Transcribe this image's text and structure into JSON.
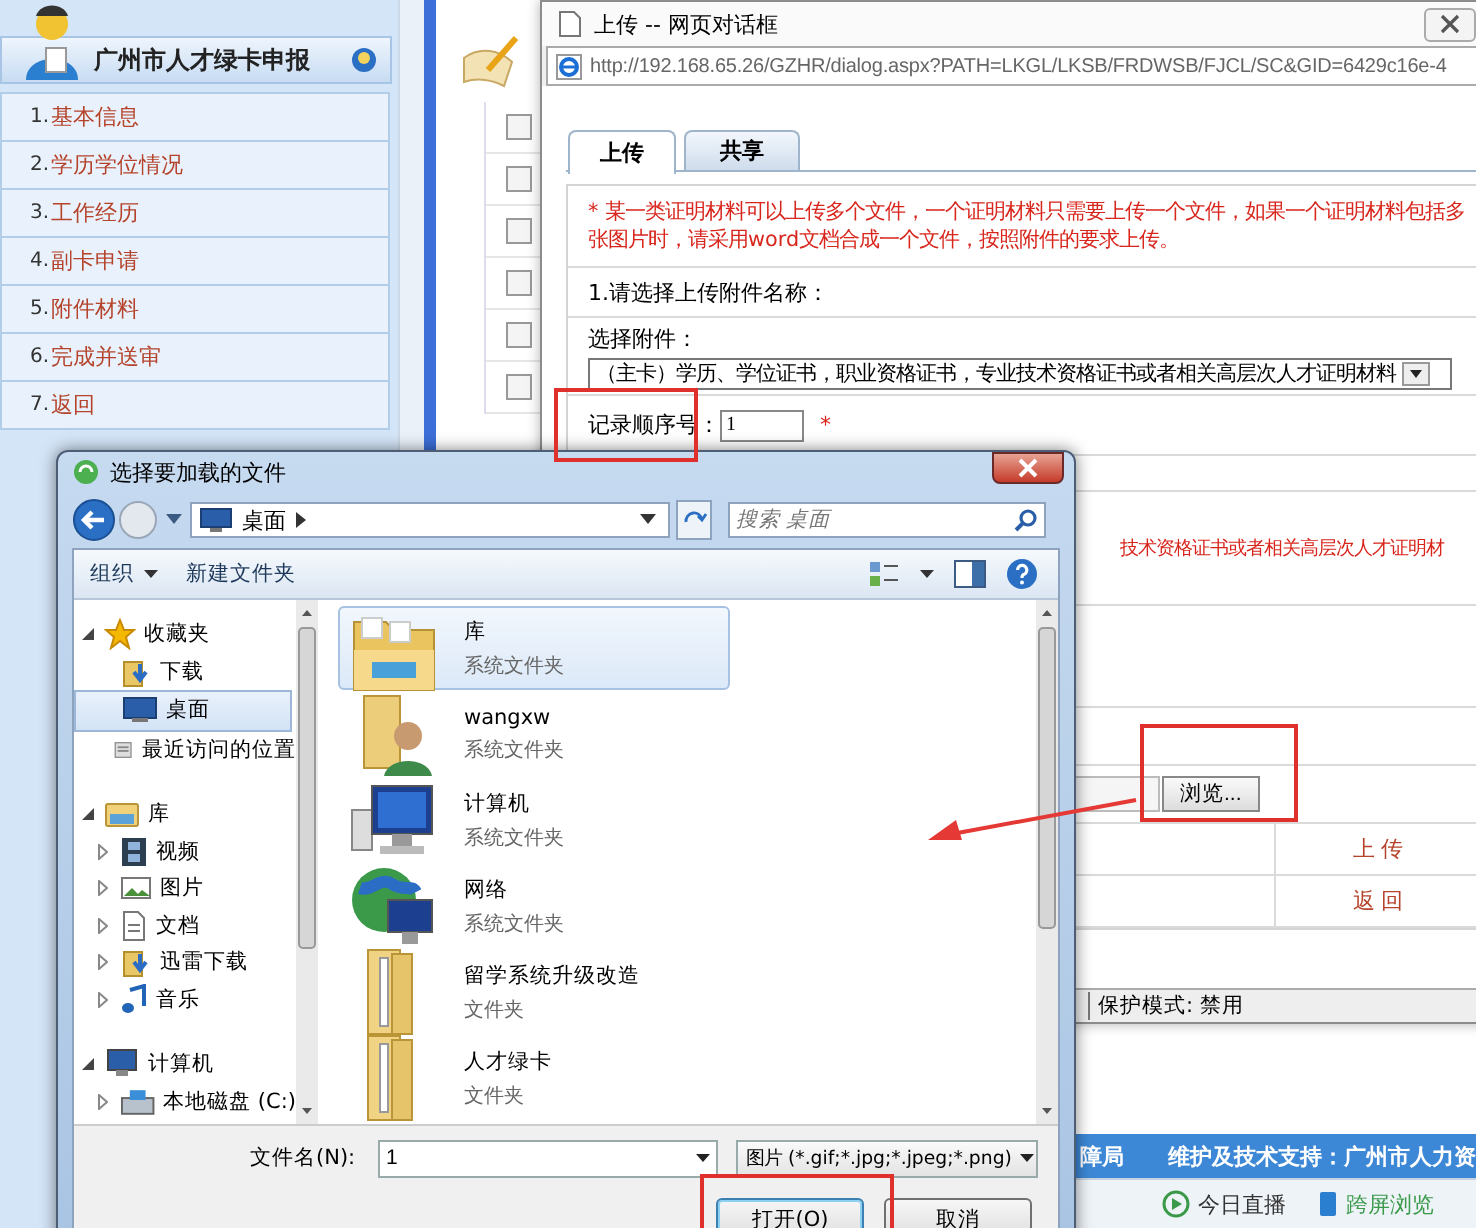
{
  "portal": {
    "title": "广州市人才绿卡申报",
    "menu": [
      {
        "number": "1.",
        "label": "基本信息"
      },
      {
        "number": "2.",
        "label": "学历学位情况"
      },
      {
        "number": "3.",
        "label": "工作经历"
      },
      {
        "number": "4.",
        "label": "副卡申请"
      },
      {
        "number": "5.",
        "label": "附件材料"
      },
      {
        "number": "6.",
        "label": "完成并送审"
      },
      {
        "number": "7.",
        "label": "返回"
      }
    ],
    "records": [
      {
        "checked": false
      },
      {
        "checked": false
      },
      {
        "checked": false
      },
      {
        "checked": false
      },
      {
        "checked": false
      },
      {
        "checked": false
      }
    ],
    "footer": {
      "text_1": "障局",
      "text_2": "维护及技术支持：广州市人力资"
    },
    "taskbar": [
      {
        "label": "今日直播",
        "kind": "live"
      },
      {
        "label": "跨屏浏览",
        "kind": "phone"
      }
    ]
  },
  "upload_dialog": {
    "title": "上传 -- 网页对话框",
    "url": "http://192.168.65.26/GZHR/dialog.aspx?PATH=LKGL/LKSB/FRDWSB/FJCL/SC&GID=6429c16e-4",
    "tabs": [
      {
        "label": "上传",
        "selected": true
      },
      {
        "label": "共享",
        "selected": false
      }
    ],
    "notice": "*  某一类证明材料可以上传多个文件，一个证明材料只需要上传一个文件，如果一个证明材料包括多张图片时，请采用word文档合成一个文件，按照附件的要求上传。",
    "step": "1.请选择上传附件名称：",
    "attachment_label": "选择附件：",
    "attachment_value": "（主卡）学历、学位证书，职业资格证书，专业技术资格证书或者相关高层次人才证明材料",
    "order_label": "记录顺序号：",
    "order_value": "1",
    "required_mark": "*",
    "hint": "技术资格证书或者相关高层次人才证明材",
    "browse_button": "浏览...",
    "actions": [
      "上 传",
      "返 回"
    ],
    "status": "保护模式: 禁用"
  },
  "file_dialog": {
    "title": "选择要加载的文件",
    "location": "桌面",
    "search_placeholder": "搜索 桌面",
    "toolbar": [
      {
        "label": "组织",
        "kind": "menu"
      },
      {
        "label": "新建文件夹",
        "kind": "plain"
      }
    ],
    "nav": [
      {
        "label": "收藏夹",
        "kind": "star",
        "selected": false,
        "expanded": true,
        "children": [
          {
            "label": "下载",
            "kind": "download",
            "selected": false
          },
          {
            "label": "桌面",
            "kind": "desktop",
            "selected": true
          },
          {
            "label": "最近访问的位置",
            "kind": "recent",
            "selected": false
          }
        ]
      },
      {
        "label": "库",
        "kind": "library",
        "selected": false,
        "expanded": true,
        "children": [
          {
            "label": "视频",
            "kind": "video",
            "selected": false,
            "expanded": false
          },
          {
            "label": "图片",
            "kind": "picture",
            "selected": false,
            "expanded": false
          },
          {
            "label": "文档",
            "kind": "document",
            "selected": false,
            "expanded": false
          },
          {
            "label": "迅雷下载",
            "kind": "download",
            "selected": false,
            "expanded": false
          },
          {
            "label": "音乐",
            "kind": "music",
            "selected": false,
            "expanded": false
          }
        ]
      },
      {
        "label": "计算机",
        "kind": "computer",
        "selected": false,
        "expanded": true,
        "children": [
          {
            "label": "本地磁盘 (C:)",
            "kind": "drive",
            "selected": false,
            "expanded": false
          }
        ]
      }
    ],
    "items": [
      {
        "name": "库",
        "type_label": "系统文件夹",
        "kind": "library",
        "selected": true
      },
      {
        "name": "wangxw",
        "type_label": "系统文件夹",
        "kind": "user",
        "selected": false
      },
      {
        "name": "计算机",
        "type_label": "系统文件夹",
        "kind": "computer",
        "selected": false
      },
      {
        "name": "网络",
        "type_label": "系统文件夹",
        "kind": "network",
        "selected": false
      },
      {
        "name": "留学系统升级改造",
        "type_label": "文件夹",
        "kind": "folder",
        "selected": false
      },
      {
        "name": "人才绿卡",
        "type_label": "文件夹",
        "kind": "folder",
        "selected": false
      }
    ],
    "filename_label": "文件名(N):",
    "filename": "1",
    "filter": "图片 (*.gif;*.jpg;*.jpeg;*.png)",
    "buttons": [
      {
        "label": "打开(O)",
        "kind": "primary"
      },
      {
        "label": "取消",
        "kind": "cancel"
      }
    ]
  }
}
